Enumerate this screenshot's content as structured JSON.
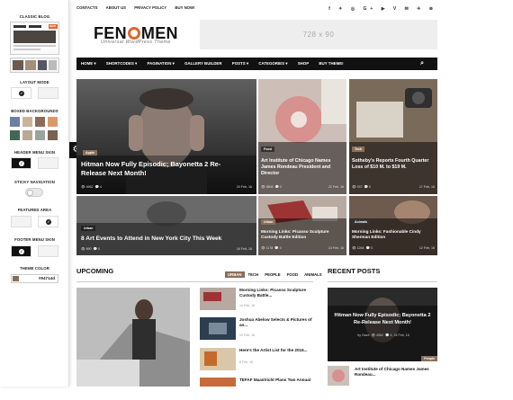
{
  "colors": {
    "accent": "#8a6f57",
    "logo_o": "#e0662a",
    "nav": "#111111"
  },
  "sidebar": {
    "classic_blog": "CLASSIC BLOG",
    "layout_mode": "LAYOUT MODE",
    "boxed_backgrounds": "BOXED BACKGROUNDS",
    "header_menu_skin": "HEADER MENU SKIN",
    "sticky_navigation": "STICKY NAVIGATION",
    "featured_area": "FEATURED AREA",
    "footer_menu_skin": "FOOTER MENU SKIN",
    "theme_color": "THEME COLOR",
    "theme_color_value": "#8a6f57",
    "theme_color_text": "#94714d",
    "new_badge": "NEW",
    "settings_icon": "gear-icon"
  },
  "topbar": {
    "links": [
      "CONTACTS",
      "ABOUT US",
      "PRIVACY POLICY",
      "BUY NOW!"
    ],
    "social": "f ✦ ◎ G+ ▶ V ✉ ✈ ⊗"
  },
  "brand": {
    "logo_a": "FEN",
    "logo_b": "MEN",
    "tagline": "Universal WordPress Theme"
  },
  "ad": {
    "text": "728 x 90"
  },
  "nav": {
    "items": [
      "HOME ▾",
      "SHORTCODES ▾",
      "PAGINATION ▾",
      "GALLERY BUILDER",
      "POSTS ▾",
      "CATEGORIES ▾",
      "SHOP",
      "BUY THEME!"
    ],
    "search_icon": "search-icon"
  },
  "featured": [
    {
      "cat": "Apple",
      "title": "Hitman Now Fully Episodic; Bayonetta 2 Re-Release Next Month!",
      "views": "4962",
      "comments": "4",
      "date": "24 Feb, 16"
    },
    {
      "cat": "Food",
      "title": "Art Institute of Chicago Names James Rondeau President and Director",
      "views": "5806",
      "comments": "0",
      "date": "22 Feb, 16"
    },
    {
      "cat": "Tech",
      "title": "Sotheby's Reports Fourth Quarter Loss of $10 M. to $19 M.",
      "views": "972",
      "comments": "0",
      "date": "17 Feb, 16"
    },
    {
      "cat": "Urban",
      "title": "8 Art Events to Attend in New York City This Week",
      "views": "890",
      "comments": "0",
      "date": "16 Feb, 16"
    },
    {
      "cat": "Urban",
      "title": "Morning Links: Picasso Sculpture Custody Battle Edition",
      "views": "1178",
      "comments": "0",
      "date": "14 Feb, 16"
    },
    {
      "cat": "Animals",
      "title": "Morning Links: Fashionable Cindy Sherman Edition",
      "views": "1264",
      "comments": "0",
      "date": "12 Feb, 16"
    }
  ],
  "upcoming": {
    "title": "UPCOMING",
    "tabs": [
      "URBAN",
      "TECH",
      "PEOPLE",
      "FOOD",
      "ANIMALS"
    ],
    "posts": [
      {
        "title": "Morning Links: Picasso Sculpture Custody Battle...",
        "date": "14 Feb, 16"
      },
      {
        "title": "Joshua Abelow Selects & Pictures of an...",
        "date": "10 Feb, 16"
      },
      {
        "title": "Here's the Artist List for the 2016...",
        "date": "6 Feb, 16"
      },
      {
        "title": "TEFAF Maastricht Plans Two Annual",
        "date": ""
      }
    ]
  },
  "recent": {
    "title": "RECENT POSTS",
    "big_title": "Hitman Now Fully Episodic; Bayonetta 2 Re-Release Next Month!",
    "big_meta_author": "by Dave",
    "big_meta_views": "4962",
    "big_meta_comments": "4",
    "big_meta_date": "24 Feb, 16",
    "big_cat": "People",
    "small_title": "Art Institute of Chicago Names James Rondeau..."
  }
}
